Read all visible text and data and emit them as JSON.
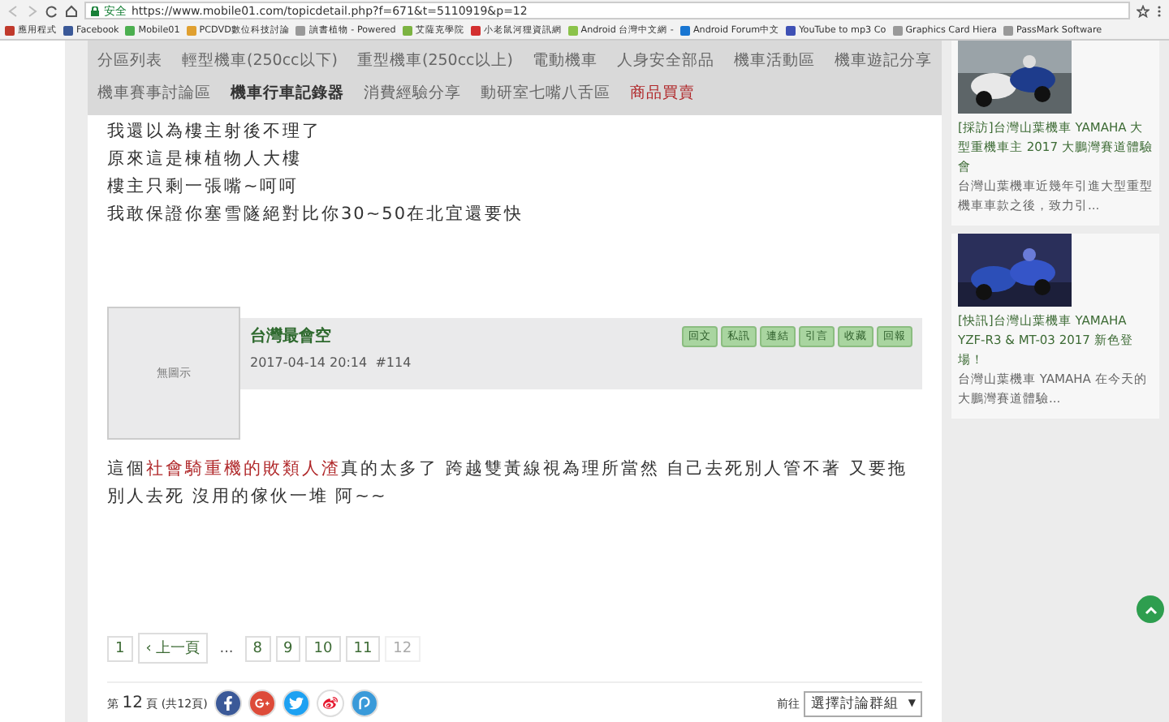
{
  "browser": {
    "secure_label": "安全",
    "url": "https://www.mobile01.com/topicdetail.php?f=671&t=5110919&p=12"
  },
  "bookmarks": [
    {
      "label": "應用程式",
      "color": "#c0392b"
    },
    {
      "label": "Facebook",
      "color": "#3b5998"
    },
    {
      "label": "Mobile01",
      "color": "#4caf50"
    },
    {
      "label": "PCDVD數位科技討論",
      "color": "#e0a030"
    },
    {
      "label": "讀書植物 - Powered",
      "color": "#999999"
    },
    {
      "label": "艾薩克學院",
      "color": "#7cb342"
    },
    {
      "label": "小老鼠河狸資訊網",
      "color": "#d32f2f"
    },
    {
      "label": "Android 台灣中文網 -",
      "color": "#8bc34a"
    },
    {
      "label": "Android Forum中文",
      "color": "#1976d2"
    },
    {
      "label": "YouTube to mp3 Co",
      "color": "#3f51b5"
    },
    {
      "label": "Graphics Card Hiera",
      "color": "#999999"
    },
    {
      "label": "PassMark Software",
      "color": "#999999"
    }
  ],
  "nav": [
    {
      "label": "分區列表",
      "selected": false,
      "kind": "link"
    },
    {
      "label": "輕型機車(250cc以下)",
      "selected": false,
      "kind": "link"
    },
    {
      "label": "重型機車(250cc以上)",
      "selected": false,
      "kind": "link"
    },
    {
      "label": "電動機車",
      "selected": false,
      "kind": "link"
    },
    {
      "label": "人身安全部品",
      "selected": false,
      "kind": "link"
    },
    {
      "label": "機車活動區",
      "selected": false,
      "kind": "link"
    },
    {
      "label": "機車遊記分享",
      "selected": false,
      "kind": "link"
    },
    {
      "label": "機車賽事討論區",
      "selected": false,
      "kind": "link"
    },
    {
      "label": "機車行車記錄器",
      "selected": true,
      "kind": "link"
    },
    {
      "label": "消費經驗分享",
      "selected": false,
      "kind": "link"
    },
    {
      "label": "動研室七嘴八舌區",
      "selected": false,
      "kind": "link"
    },
    {
      "label": "商品買賣",
      "selected": false,
      "kind": "promo"
    }
  ],
  "previous_lines": [
    "我還以為樓主射後不理了",
    "原來這是棟植物人大樓",
    "樓主只剩一張嘴~呵呵",
    "我敢保證你塞雪隧絕對比你30~50在北宜還要快"
  ],
  "post": {
    "avatar_label": "無圖示",
    "author": "台灣最會空",
    "timestamp": "2017-04-14 20:14",
    "floor": "#114",
    "actions": [
      "回文",
      "私訊",
      "連結",
      "引言",
      "收藏",
      "回報"
    ],
    "body": [
      {
        "text": "這個",
        "kind": "plain"
      },
      {
        "text": "社會騎重機的敗類人渣",
        "kind": "link"
      },
      {
        "text": "真的太多了 跨越雙黃線視為理所當然 自己去死別人管不著 又要拖別人去死 沒用的傢伙一堆 阿~~",
        "kind": "plain"
      }
    ]
  },
  "pagination": [
    {
      "label": "1",
      "kind": "page",
      "selected": false
    },
    {
      "label": "‹ 上一頁",
      "kind": "page",
      "selected": false
    },
    {
      "label": "...",
      "kind": "ellipsis"
    },
    {
      "label": "8",
      "kind": "page",
      "selected": false
    },
    {
      "label": "9",
      "kind": "page",
      "selected": false
    },
    {
      "label": "10",
      "kind": "page",
      "selected": false
    },
    {
      "label": "11",
      "kind": "page",
      "selected": false
    },
    {
      "label": "12",
      "kind": "page",
      "selected": true
    }
  ],
  "page_info": {
    "prefix": "第",
    "current": "12",
    "suffix": "頁 (共12頁)"
  },
  "share": [
    {
      "kind": "facebook",
      "color": "#3b5998"
    },
    {
      "kind": "googleplus",
      "color": "#dd4b39"
    },
    {
      "kind": "twitter",
      "color": "#1da1f2"
    },
    {
      "kind": "weibo",
      "color": "#ffffff"
    },
    {
      "kind": "plurk",
      "color": "#3a9ad9"
    }
  ],
  "goto": {
    "label": "前往",
    "select": "選擇討論群組",
    "arrow": "▼"
  },
  "sidebar": [
    {
      "title": "[採訪]台灣山葉機車 YAMAHA 大型重機車主 2017 大鵬灣賽道體驗會",
      "desc": "台灣山葉機車近幾年引進大型重型機車車款之後，致力引..."
    },
    {
      "title": "[快訊]台灣山葉機車 YAMAHA YZF-R3 & MT-03 2017 新色登場！",
      "desc": "台灣山葉機車 YAMAHA 在今天的大鵬灣賽道體驗..."
    }
  ]
}
